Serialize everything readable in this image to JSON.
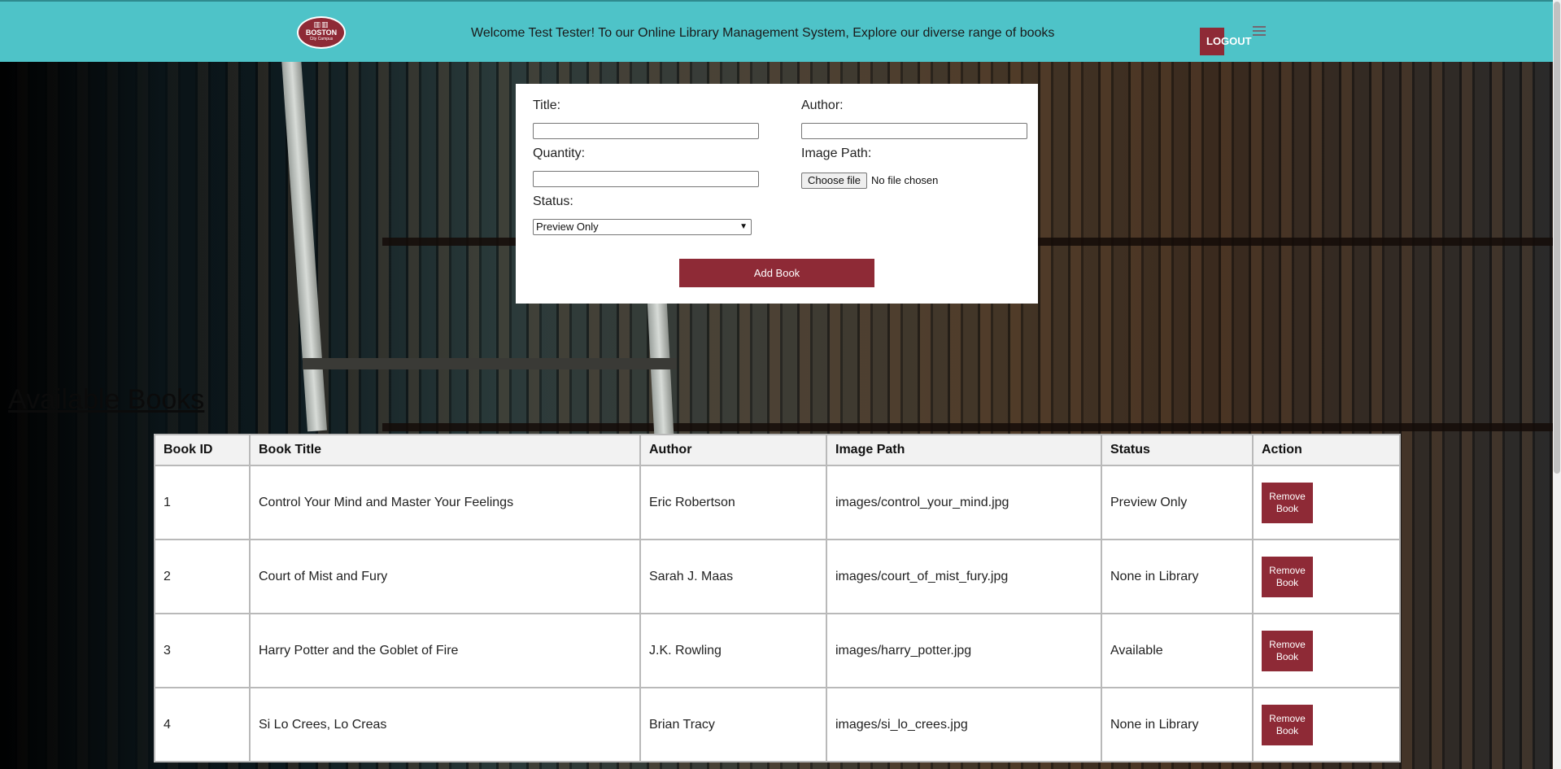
{
  "header": {
    "logo": {
      "top": "▥▥",
      "name": "BOSTON",
      "sub": "City Campus"
    },
    "welcome": "Welcome Test Tester! To our Online Library Management System, Explore our diverse range of books",
    "logout_label": "LOGOUT"
  },
  "form": {
    "title_label": "Title:",
    "author_label": "Author:",
    "quantity_label": "Quantity:",
    "image_path_label": "Image Path:",
    "choose_file_label": "Choose file",
    "no_file_text": "No file chosen",
    "status_label": "Status:",
    "status_selected": "Preview Only",
    "add_button_label": "Add Book"
  },
  "books_section": {
    "title": "Available Books",
    "columns": [
      "Book ID",
      "Book Title",
      "Author",
      "Image Path",
      "Status",
      "Action"
    ],
    "rows": [
      {
        "id": "1",
        "title": "Control Your Mind and Master Your Feelings",
        "author": "Eric Robertson",
        "image_path": "images/control_your_mind.jpg",
        "status": "Preview Only",
        "action": "Remove Book"
      },
      {
        "id": "2",
        "title": "Court of Mist and Fury",
        "author": "Sarah J. Maas",
        "image_path": "images/court_of_mist_fury.jpg",
        "status": "None in Library",
        "action": "Remove Book"
      },
      {
        "id": "3",
        "title": "Harry Potter and the Goblet of Fire",
        "author": "J.K. Rowling",
        "image_path": "images/harry_potter.jpg",
        "status": "Available",
        "action": "Remove Book"
      },
      {
        "id": "4",
        "title": "Si Lo Crees, Lo Creas",
        "author": "Brian Tracy",
        "image_path": "images/si_lo_crees.jpg",
        "status": "None in Library",
        "action": "Remove Book"
      }
    ]
  },
  "colors": {
    "header": "#4ec3c8",
    "brand": "#8e2a36"
  }
}
